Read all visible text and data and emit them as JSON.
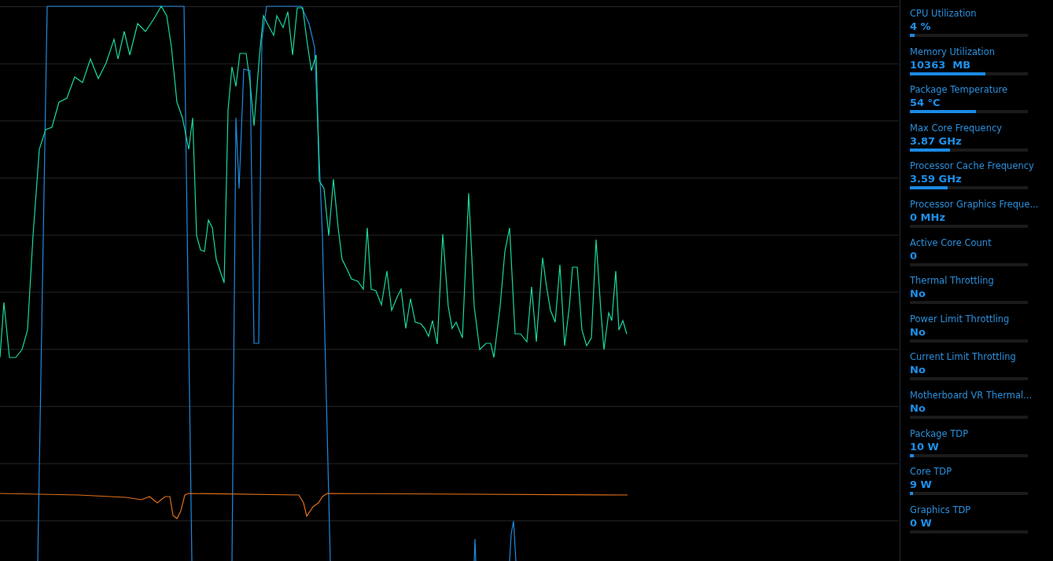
{
  "metrics": [
    {
      "label": "CPU Utilization",
      "value": "4 %",
      "level": 0.04
    },
    {
      "label": "Memory Utilization",
      "value": "10363  MB",
      "level": 0.64
    },
    {
      "label": "Package Temperature",
      "value": "54 °C",
      "level": 0.56
    },
    {
      "label": "Max Core Frequency",
      "value": "3.87 GHz",
      "level": 0.34
    },
    {
      "label": "Processor Cache Frequency",
      "value": "3.59 GHz",
      "level": 0.32
    },
    {
      "label": "Processor Graphics Freque...",
      "value": "0 MHz",
      "level": 0
    },
    {
      "label": "Active Core Count",
      "value": "0",
      "level": 0
    },
    {
      "label": "Thermal Throttling",
      "value": "No",
      "level": 0
    },
    {
      "label": "Power Limit Throttling",
      "value": "No",
      "level": 0
    },
    {
      "label": "Current Limit Throttling",
      "value": "No",
      "level": 0
    },
    {
      "label": "Motherboard VR Thermal...",
      "value": "No",
      "level": 0
    },
    {
      "label": "Package TDP",
      "value": "10 W",
      "level": 0.035
    },
    {
      "label": "Core TDP",
      "value": "9 W",
      "level": 0.025
    },
    {
      "label": "Graphics TDP",
      "value": "0 W",
      "level": 0
    }
  ]
}
